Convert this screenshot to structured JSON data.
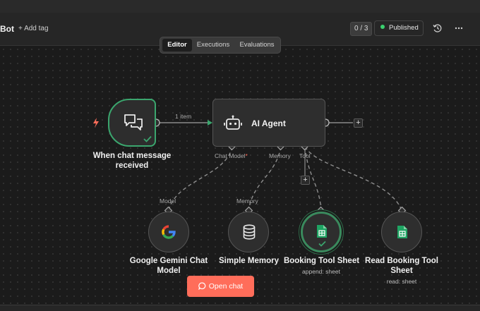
{
  "header": {
    "workflow_name": "Bot",
    "add_tag": "+ Add tag",
    "counter": "0 / 3",
    "publish_status": "Published"
  },
  "tabs": [
    {
      "label": "Editor",
      "active": true
    },
    {
      "label": "Executions",
      "active": false
    },
    {
      "label": "Evaluations",
      "active": false
    }
  ],
  "nodes": {
    "trigger": {
      "label_line1": "When chat message",
      "label_line2": "received",
      "icon": "chat-icon"
    },
    "agent": {
      "label": "AI Agent",
      "icon": "robot-icon"
    },
    "gemini": {
      "label_line1": "Google Gemini Chat",
      "label_line2": "Model",
      "icon": "google-icon"
    },
    "memory": {
      "label": "Simple Memory",
      "icon": "database-icon"
    },
    "booking_sheet": {
      "label": "Booking Tool Sheet",
      "sublabel": "append: sheet",
      "icon": "sheets-icon"
    },
    "read_booking": {
      "label_line1": "Read Booking Tool",
      "label_line2": "Sheet",
      "sublabel": "read: sheet",
      "icon": "sheets-icon"
    }
  },
  "ports": {
    "chat_model": "Chat Model",
    "required_mark": "*",
    "memory": "Memory",
    "tool": "Tool",
    "model_input": "Model",
    "memory_input": "Memory"
  },
  "edge_label": "1 item",
  "open_chat": "Open chat",
  "colors": {
    "success": "#3ba66e",
    "accent": "#ff6d5a",
    "published_dot": "#3bd16f",
    "trigger_bolt": "#ff6d5a"
  }
}
